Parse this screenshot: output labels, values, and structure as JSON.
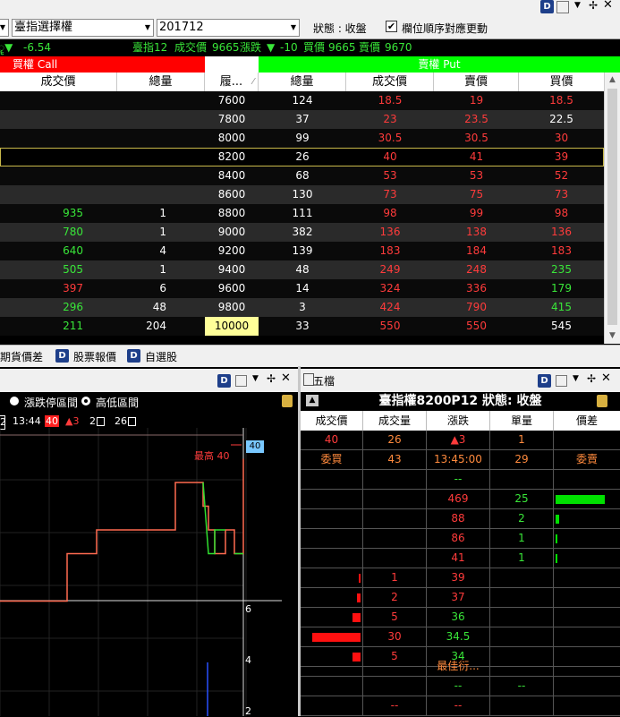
{
  "toolbar": {
    "product_select": "臺指選擇權",
    "month_select": "201712",
    "status": "狀態 : 收盤",
    "checkbox_label": "欄位順序對應更動",
    "checked": true
  },
  "quote": {
    "change": "-6.54",
    "symbol": "臺指12",
    "trade_label": "成交價",
    "trade_price": "9665",
    "change_label": "漲跌",
    "change_value": "-10",
    "bid_label": "買價",
    "bid": "9665",
    "ask_label": "賣價",
    "ask": "9670"
  },
  "banner": {
    "call": "買權 Call",
    "put": "賣權 Put"
  },
  "table": {
    "headers": [
      "成交價",
      "總量",
      "履...",
      "總量",
      "成交價",
      "賣價",
      "買價"
    ],
    "rows": [
      {
        "c_price": "",
        "c_vol": "",
        "strike": "7600",
        "p_vol": "124",
        "p_price": "18.5",
        "p_ask": "19",
        "p_bid": "18.5",
        "p_bid_color": "red"
      },
      {
        "c_price": "",
        "c_vol": "",
        "strike": "7800",
        "p_vol": "37",
        "p_price": "23",
        "p_ask": "23.5",
        "p_bid": "22.5",
        "p_bid_color": "white"
      },
      {
        "c_price": "",
        "c_vol": "",
        "strike": "8000",
        "p_vol": "99",
        "p_price": "30.5",
        "p_ask": "30.5",
        "p_bid": "30",
        "p_bid_color": "red"
      },
      {
        "c_price": "",
        "c_vol": "",
        "strike": "8200",
        "p_vol": "26",
        "p_price": "40",
        "p_ask": "41",
        "p_bid": "39",
        "p_bid_color": "red"
      },
      {
        "c_price": "",
        "c_vol": "",
        "strike": "8400",
        "p_vol": "68",
        "p_price": "53",
        "p_ask": "53",
        "p_bid": "52",
        "p_bid_color": "red"
      },
      {
        "c_price": "",
        "c_vol": "",
        "strike": "8600",
        "p_vol": "130",
        "p_price": "73",
        "p_ask": "75",
        "p_bid": "73",
        "p_bid_color": "red"
      },
      {
        "c_price": "935",
        "c_vol": "1",
        "strike": "8800",
        "p_vol": "111",
        "p_price": "98",
        "p_ask": "99",
        "p_bid": "98",
        "p_bid_color": "red",
        "c_color": "green"
      },
      {
        "c_price": "780",
        "c_vol": "1",
        "strike": "9000",
        "p_vol": "382",
        "p_price": "136",
        "p_ask": "138",
        "p_bid": "136",
        "p_bid_color": "red",
        "c_color": "green"
      },
      {
        "c_price": "640",
        "c_vol": "4",
        "strike": "9200",
        "p_vol": "139",
        "p_price": "183",
        "p_ask": "184",
        "p_bid": "183",
        "p_bid_color": "red",
        "c_color": "green"
      },
      {
        "c_price": "505",
        "c_vol": "1",
        "strike": "9400",
        "p_vol": "48",
        "p_price": "249",
        "p_ask": "248",
        "p_bid": "235",
        "p_bid_color": "green",
        "c_color": "green"
      },
      {
        "c_price": "397",
        "c_vol": "6",
        "strike": "9600",
        "p_vol": "14",
        "p_price": "324",
        "p_ask": "336",
        "p_bid": "179",
        "p_bid_color": "green",
        "c_color": "red"
      },
      {
        "c_price": "296",
        "c_vol": "48",
        "strike": "9800",
        "p_vol": "3",
        "p_price": "424",
        "p_ask": "790",
        "p_bid": "415",
        "p_bid_color": "green",
        "c_color": "green"
      },
      {
        "c_price": "211",
        "c_vol": "204",
        "strike": "10000",
        "p_vol": "33",
        "p_price": "550",
        "p_ask": "550",
        "p_bid": "545",
        "p_bid_color": "white",
        "c_color": "green"
      }
    ]
  },
  "tabs": [
    "期貨價差",
    "股票報價",
    "自選股"
  ],
  "chart_panel": {
    "radio1": "漲跌停區間",
    "radio2": "高低區間",
    "info_time": "13:44",
    "info_price": "40",
    "info_change": "▲3",
    "info_a": "2",
    "info_b": "26",
    "high_label": "最高 40",
    "high_tag": "40",
    "axis_labels": [
      "6",
      "4",
      "2"
    ]
  },
  "chart_data": {
    "type": "line",
    "title": "",
    "high": 40,
    "series": [
      {
        "values": [
          34,
          34,
          36,
          36,
          37,
          37,
          39,
          39,
          38,
          37,
          36,
          37,
          36,
          40
        ]
      }
    ]
  },
  "five": {
    "panel_title": "五檔",
    "title": "臺指權8200P12  狀態: 收盤",
    "headers": [
      "成交價",
      "成交量",
      "漲跌",
      "單量",
      "價差"
    ],
    "summary1": {
      "price": "40",
      "vol": "26",
      "chg": "▲3",
      "qty": "1"
    },
    "summary2": {
      "a": "委買",
      "b": "43",
      "c": "13:45:00",
      "d": "29",
      "e": "委賣"
    },
    "dash": "--",
    "asks": [
      {
        "price": "469",
        "qty": "25",
        "bar": 1.0
      },
      {
        "price": "88",
        "qty": "2",
        "bar": 0.08
      },
      {
        "price": "86",
        "qty": "1",
        "bar": 0.04
      },
      {
        "price": "41",
        "qty": "1",
        "bar": 0.04
      }
    ],
    "bids": [
      {
        "qty": "1",
        "price": "39",
        "bar": 0.03
      },
      {
        "qty": "2",
        "price": "37",
        "bar": 0.07
      },
      {
        "qty": "5",
        "price": "36",
        "bar": 0.17
      },
      {
        "qty": "30",
        "price": "34.5",
        "bar": 1.0
      },
      {
        "qty": "5",
        "price": "34",
        "bar": 0.17
      }
    ],
    "best_derived": "最佳衍...",
    "tail_dashes": [
      "--",
      "--",
      "--",
      "--"
    ]
  }
}
